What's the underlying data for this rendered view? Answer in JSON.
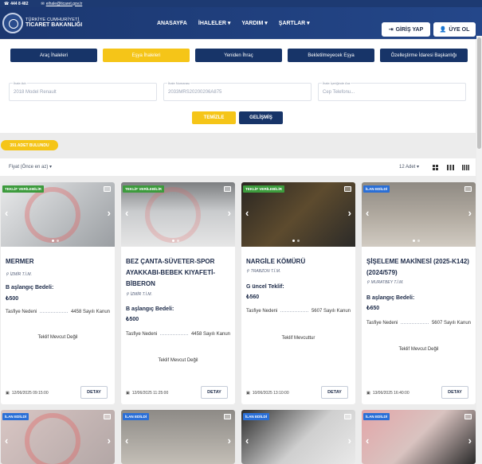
{
  "topbar": {
    "phone": "444 8 482",
    "email": "eihale@ticaret.gov.tr"
  },
  "logo": {
    "line1": "TÜRKİYE CUMHURİYETİ",
    "line2": "TİCARET BAKANLIĞI"
  },
  "nav": {
    "items": [
      "ANASAYFA",
      "İHALELER",
      "YARDIM",
      "ŞARTLAR"
    ]
  },
  "auth": {
    "login": "GİRİŞ YAP",
    "signup": "ÜYE OL"
  },
  "tabs": [
    "Araç İhaleleri",
    "Eşya İhaleleri",
    "Yeniden İhraç",
    "Bekletilmeyecek Eşya",
    "Özelleştirme İdaresi Başkanlığı"
  ],
  "filters": {
    "ihale_adi": {
      "label": "İhale Adı",
      "placeholder": "2018 Model Renault"
    },
    "ihale_no": {
      "label": "İhale Numarası",
      "placeholder": "2033MRS20200206A875"
    },
    "ihale_icerik": {
      "label": "İhale İçeriğinde Ara",
      "placeholder": "Cep Telefonu..."
    },
    "clear": "TEMİZLE",
    "advanced": "GELİŞMİŞ"
  },
  "result_count": "391 ADET BULUNDU",
  "sort": {
    "label": "Fiyat (Önce en az)",
    "count": "12 Adet"
  },
  "colors": {
    "navy": "#173468",
    "yellow": "#f5c518",
    "green_tag": "#3d9b3d",
    "blue_tag": "#2b6fd6"
  },
  "cards": [
    {
      "tag": "TEKLİF VERİLEBİLİR",
      "title": "MERMER",
      "location": "İZMİR T.İ.M.",
      "price_label": "B aşlangıç Bedeli:",
      "price": "₺500",
      "reason_label": "Tasfiye Nedeni",
      "reason": "4458 Sayılı Kanun",
      "offer": "Teklif Mevcut Değil",
      "date": "12/06/2025 09:15:00",
      "detail": "DETAY"
    },
    {
      "tag": "TEKLİF VERİLEBİLİR",
      "title": "BEZ ÇANTA-SÜVETER-SPOR AYAKKABI-BEBEK KIYAFETİ-BİBERON",
      "location": "İZMİR T.İ.M.",
      "price_label": "B aşlangıç Bedeli:",
      "price": "₺500",
      "reason_label": "Tasfiye Nedeni",
      "reason": "4458 Sayılı Kanun",
      "offer": "Teklif Mevcut Değil",
      "date": "12/06/2025 11:25:00",
      "detail": "DETAY"
    },
    {
      "tag": "TEKLİF VERİLEBİLİR",
      "title": "NARGİLE KÖMÜRÜ",
      "location": "TRABZON T.İ.M.",
      "price_label": "G üncel Teklif:",
      "price": "₺560",
      "reason_label": "Tasfiye Nedeni",
      "reason": "5607 Sayılı Kanun",
      "offer": "Teklif Mevcuttur",
      "date": "10/06/2025 13:10:00",
      "detail": "DETAY"
    },
    {
      "tag": "İLAN EDİLDİ",
      "title": "ŞİŞELEME MAKİNESİ (2025-K142) (2024/579)",
      "location": "MURATBEY T.İ.M.",
      "price_label": "B aşlangıç Bedeli:",
      "price": "₺650",
      "reason_label": "Tasfiye Nedeni",
      "reason": "5607 Sayılı Kanun",
      "offer": "Teklif Mevcut Değil",
      "date": "13/06/2025 16:40:00",
      "detail": "DETAY"
    }
  ],
  "cards_row2": [
    {
      "tag": "İLAN EDİLDİ"
    },
    {
      "tag": "İLAN EDİLDİ"
    },
    {
      "tag": "İLAN EDİLDİ"
    },
    {
      "tag": "İLAN EDİLDİ"
    }
  ]
}
